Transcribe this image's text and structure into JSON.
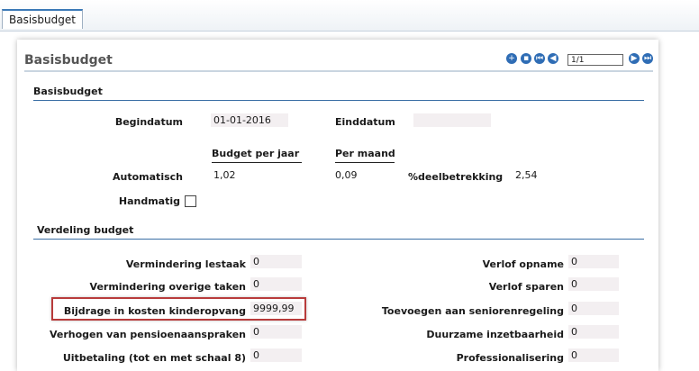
{
  "tab": {
    "label": "Basisbudget"
  },
  "header": {
    "title": "Basisbudget",
    "pager": "1/1",
    "icons": [
      "add-icon",
      "delete-icon",
      "first-record-icon",
      "previous-record-icon",
      "next-record-icon",
      "last-record-icon"
    ]
  },
  "section1": {
    "title": "Basisbudget",
    "begindatum_label": "Begindatum",
    "begindatum_value": "01-01-2016",
    "einddatum_label": "Einddatum",
    "einddatum_value": "",
    "budget_per_jaar_label": "Budget per jaar",
    "per_maand_label": "Per maand",
    "automatisch_label": "Automatisch",
    "automatisch_jaar": "1,02",
    "automatisch_maand": "0,09",
    "deelbetrekking_label": "%deelbetrekking",
    "deelbetrekking_value": "2,54",
    "handmatig_label": "Handmatig",
    "handmatig_checked": false
  },
  "section2": {
    "title": "Verdeling budget",
    "left": [
      {
        "label": "Vermindering lestaak",
        "value": "0"
      },
      {
        "label": "Vermindering overige taken",
        "value": "0"
      },
      {
        "label": "Bijdrage in kosten kinderopvang",
        "value": "9999,99"
      },
      {
        "label": "Verhogen van pensioenaanspraken",
        "value": "0"
      },
      {
        "label": "Uitbetaling (tot en met schaal 8)",
        "value": "0"
      }
    ],
    "right": [
      {
        "label": "Verlof opname",
        "value": "0"
      },
      {
        "label": "Verlof sparen",
        "value": "0"
      },
      {
        "label": "Toevoegen aan seniorenregeling",
        "value": "0"
      },
      {
        "label": "Duurzame inzetbaarheid",
        "value": "0"
      },
      {
        "label": "Professionalisering",
        "value": "0"
      }
    ]
  },
  "colors": {
    "accent": "#2f6db5",
    "highlight": "#b83b3b",
    "field_bg": "#f3eff1"
  }
}
